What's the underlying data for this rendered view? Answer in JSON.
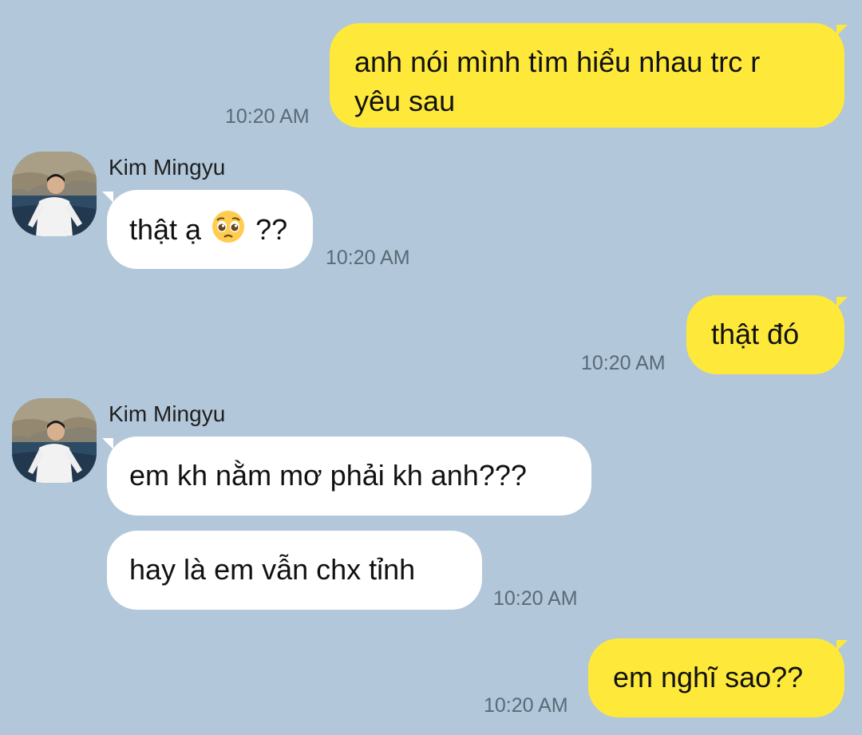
{
  "contact": {
    "name": "Kim Mingyu"
  },
  "messages": [
    {
      "sender": "me",
      "text_line1": "anh nói mình tìm hiểu nhau trc r",
      "text_line2": "yêu sau",
      "time": "10:20 AM"
    },
    {
      "sender": "Kim Mingyu",
      "text_before_emoji": "thật ạ",
      "emoji": "pleading-face",
      "text_after_emoji": "??",
      "time": "10:20 AM"
    },
    {
      "sender": "me",
      "text": "thật đó",
      "time": "10:20 AM"
    },
    {
      "sender": "Kim Mingyu",
      "text": "em kh nằm mơ phải kh anh???"
    },
    {
      "sender": "Kim Mingyu",
      "text": "hay là em vẫn chx tỉnh",
      "time": "10:20 AM"
    },
    {
      "sender": "me",
      "text": "em nghĩ sao??",
      "time": "10:20 AM"
    }
  ],
  "colors": {
    "background": "#b2c7d9",
    "my_bubble": "#fee93b",
    "their_bubble": "#ffffff",
    "timestamp": "#5a6a78"
  }
}
